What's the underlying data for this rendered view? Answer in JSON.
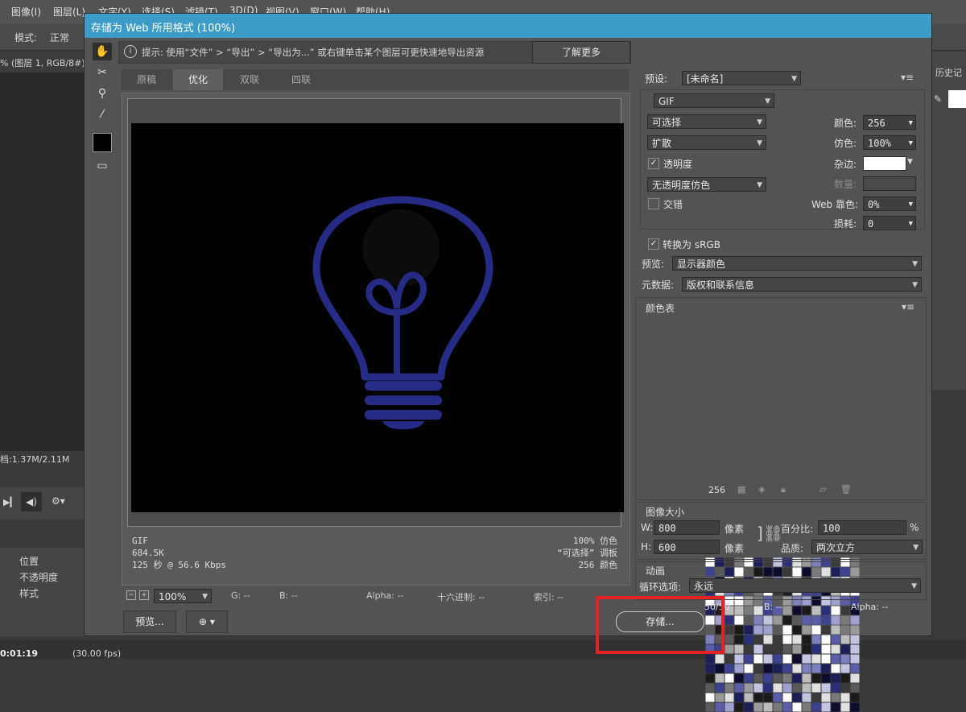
{
  "app_menu": [
    "图像(I)",
    "图层(L)",
    "文字(Y)",
    "选择(S)",
    "滤镜(T)",
    "3D(D)",
    "视图(V)",
    "窗口(W)",
    "帮助(H)"
  ],
  "options_bar": {
    "mode_label": "模式:",
    "mode_value": "正常"
  },
  "doc_tab": "% (图层 1, RGB/8#)",
  "doc_status": "档:1.37M/2.11M",
  "layers_panel": {
    "items": [
      "位置",
      "不透明度",
      "样式"
    ]
  },
  "bottom_bar": {
    "time": "0:01:19",
    "fps": "(30.00 fps)"
  },
  "right_panel_title": "历史记",
  "dialog": {
    "title": "存储为 Web 所用格式 (100%)",
    "hint": "提示: 使用“文件” > “导出” > “导出为...” 或右键单击某个图层可更快速地导出资源",
    "learn_more": "了解更多",
    "tabs": [
      "原稿",
      "优化",
      "双联",
      "四联"
    ],
    "active_tab": "优化",
    "info_left": [
      "GIF",
      "684.5K",
      "125 秒 @ 56.6 Kbps"
    ],
    "info_right": [
      "100% 仿色",
      "“可选择” 调板",
      "256 颜色"
    ],
    "status": {
      "zoom": "100%",
      "g": "G: --",
      "b": "B: --",
      "alpha": "Alpha: --",
      "hex": "十六进制: --",
      "index": "索引: --"
    },
    "preview_button": "预览...",
    "save_button": "存储...",
    "settings": {
      "preset_label": "预设:",
      "preset_value": "[未命名]",
      "format": "GIF",
      "reduction": "可选择",
      "dither_algo": "扩散",
      "transparency_label": "透明度",
      "transparency_checked": true,
      "transparency_dither": "无透明度仿色",
      "interlaced_label": "交错",
      "interlaced_checked": false,
      "colors_label": "颜色:",
      "colors_value": "256",
      "dither_label": "仿色:",
      "dither_value": "100%",
      "matte_label": "杂边:",
      "amount_label": "数量:",
      "web_snap_label": "Web 靠色:",
      "web_snap_value": "0%",
      "lossy_label": "损耗:",
      "lossy_value": "0",
      "srgb_label": "转换为 sRGB",
      "srgb_checked": true,
      "preview_label": "预览:",
      "preview_value": "显示器颜色",
      "metadata_label": "元数据:",
      "metadata_value": "版权和联系信息"
    },
    "color_table": {
      "title": "颜色表",
      "count": "256"
    },
    "image_size": {
      "title": "图像大小",
      "w_label": "W:",
      "w_value": "800",
      "w_unit": "像素",
      "h_label": "H:",
      "h_value": "600",
      "h_unit": "像素",
      "percent_label": "百分比:",
      "percent_value": "100",
      "percent_unit": "%",
      "quality_label": "品质:",
      "quality_value": "两次立方"
    },
    "animation": {
      "title": "动画",
      "loop_label": "循环选项:",
      "loop_value": "永远",
      "frame": "50/50",
      "b": "B: --",
      "alpha": "Alpha: --"
    }
  },
  "colors": {
    "title_bar": "#3d9cc7",
    "highlight": "#e52222",
    "bulb": "#262c86"
  }
}
